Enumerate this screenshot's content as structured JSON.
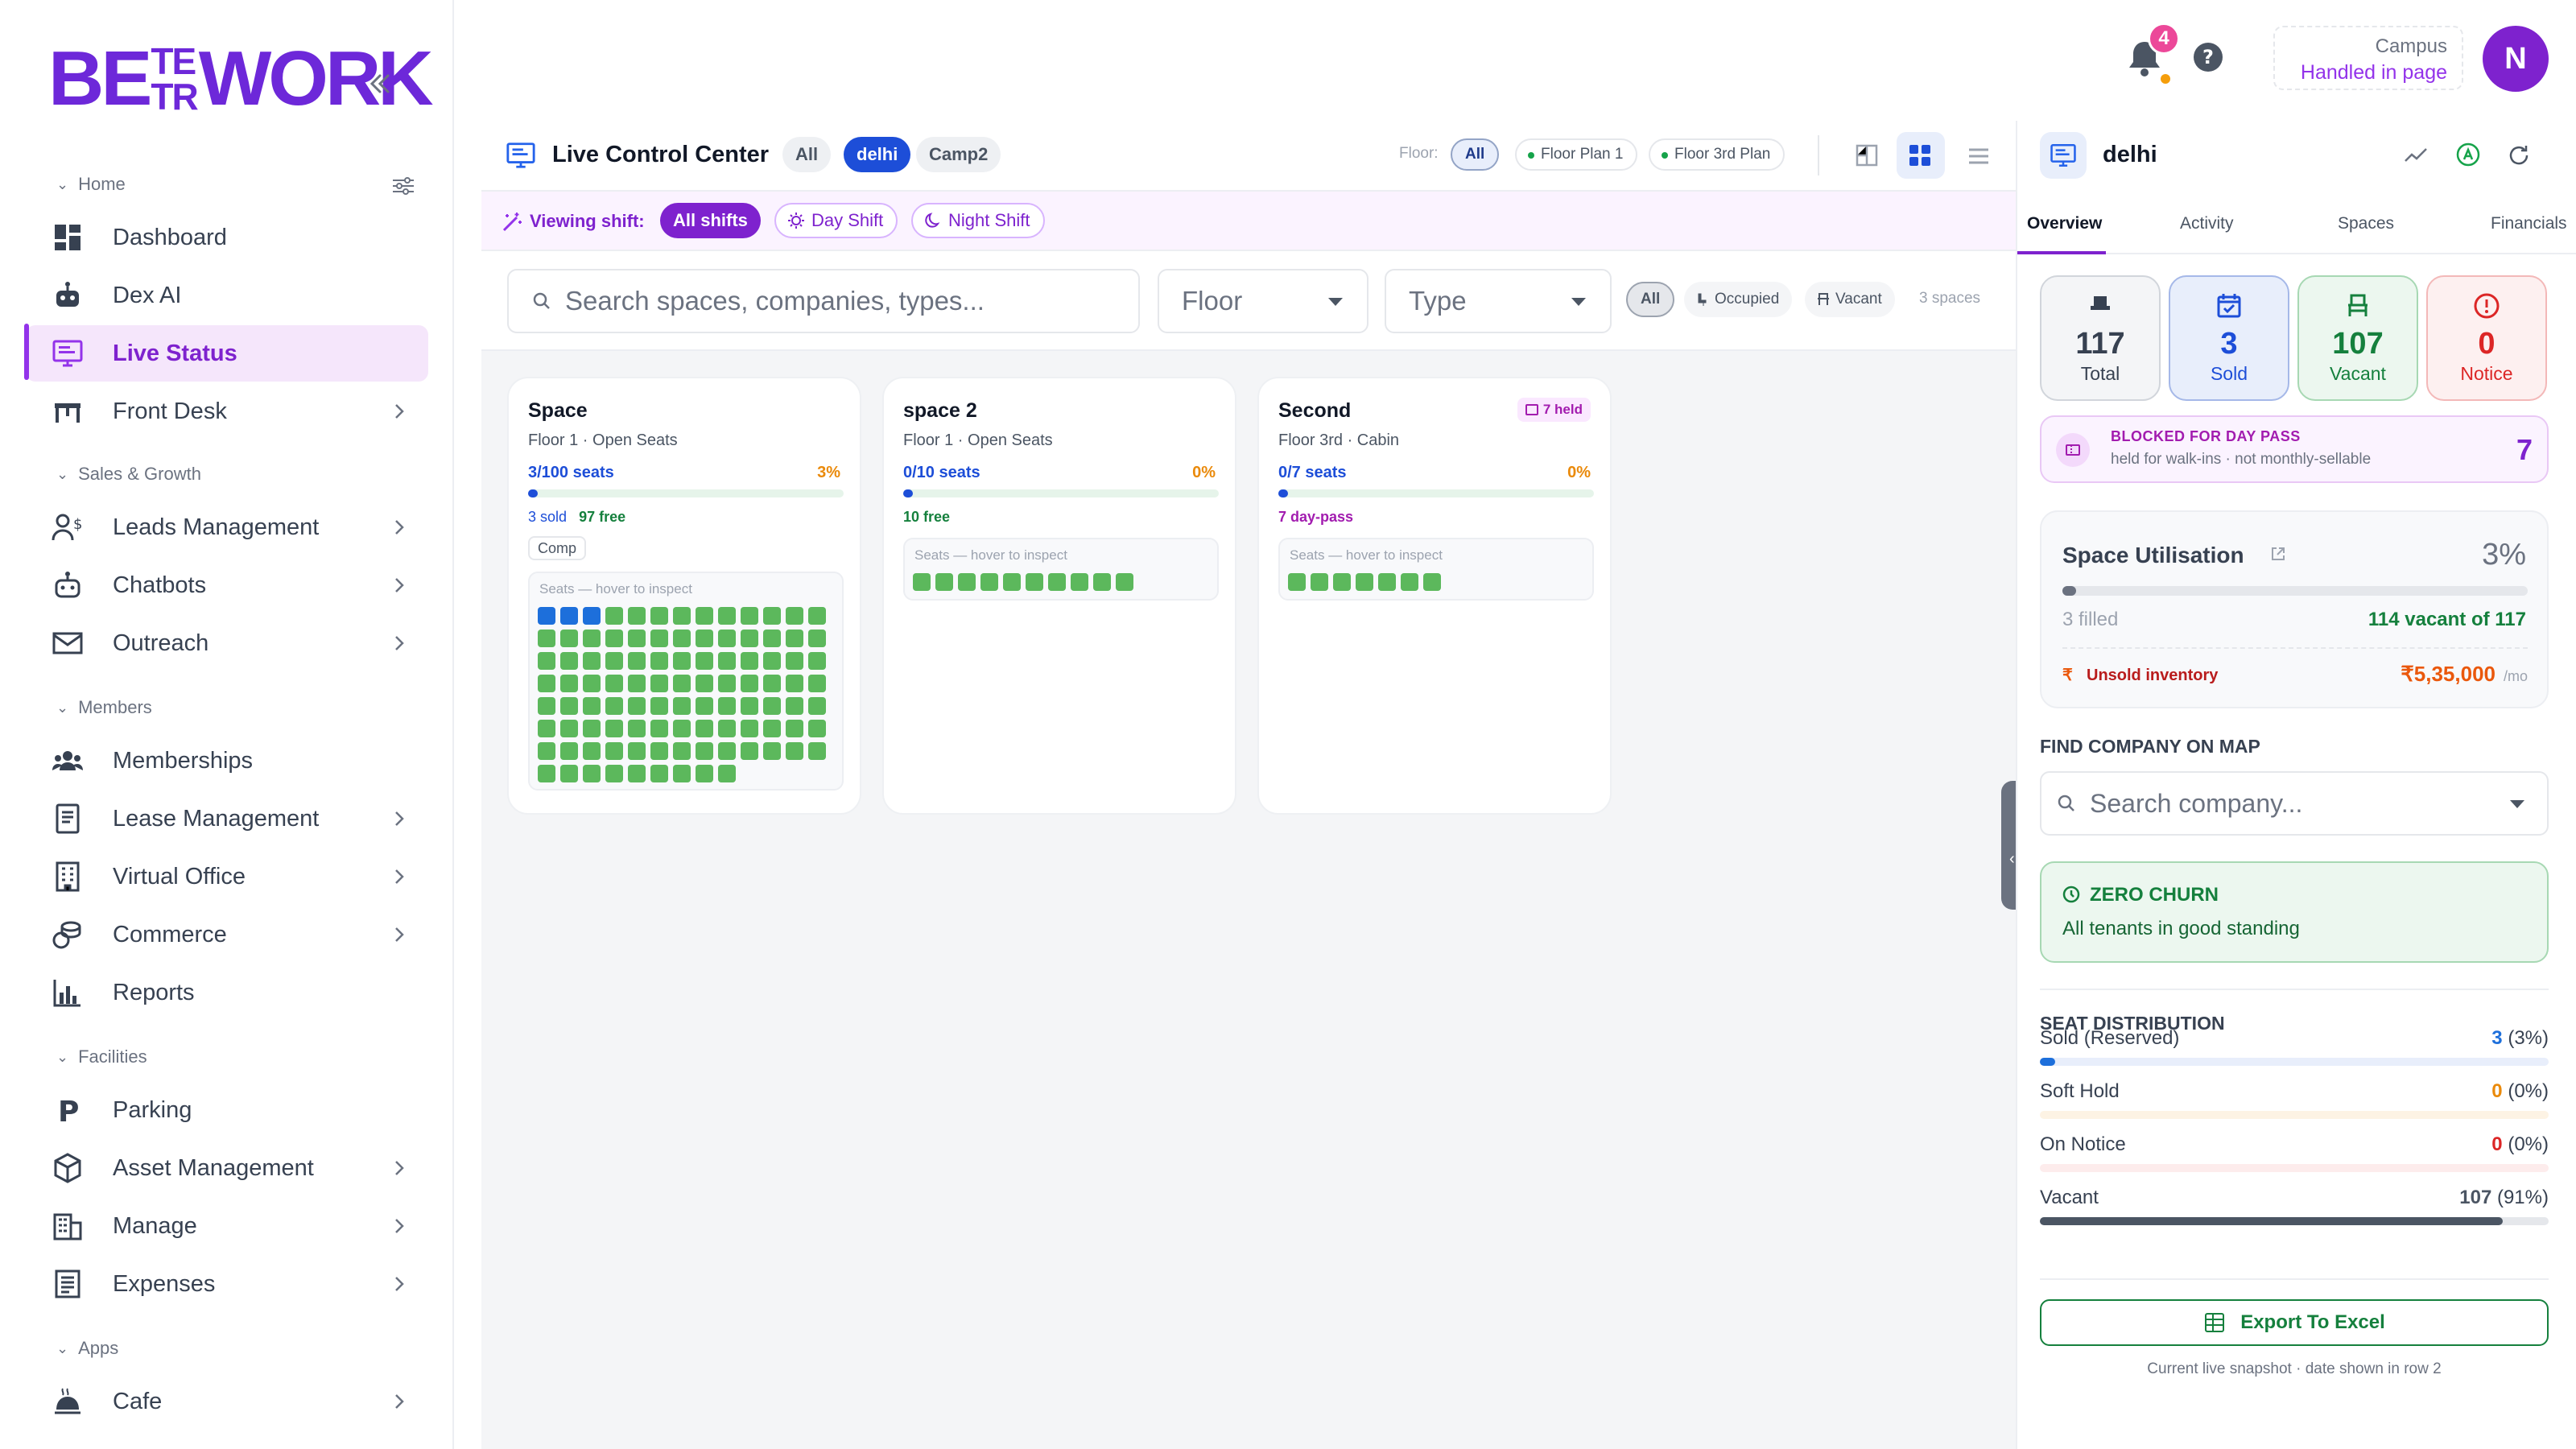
{
  "brand": {
    "logo_left": "BE",
    "logo_stack_top": "TE",
    "logo_stack_bottom": "TR",
    "logo_right": "WORK"
  },
  "sidebar": {
    "sections": {
      "home": "Home",
      "sales": "Sales & Growth",
      "members": "Members",
      "facilities": "Facilities",
      "apps": "Apps"
    },
    "items": [
      {
        "label": "Dashboard",
        "icon": "grid-icon"
      },
      {
        "label": "Dex AI",
        "icon": "robot-icon"
      },
      {
        "label": "Live Status",
        "icon": "monitor-icon",
        "active": true
      },
      {
        "label": "Front Desk",
        "icon": "desk-icon"
      },
      {
        "label": "Leads Management",
        "icon": "users-dollar-icon"
      },
      {
        "label": "Chatbots",
        "icon": "chatbot-icon"
      },
      {
        "label": "Outreach",
        "icon": "mail-icon"
      },
      {
        "label": "Memberships",
        "icon": "group-icon"
      },
      {
        "label": "Lease Management",
        "icon": "document-icon"
      },
      {
        "label": "Virtual Office",
        "icon": "building-icon"
      },
      {
        "label": "Commerce",
        "icon": "coins-icon"
      },
      {
        "label": "Reports",
        "icon": "bar-chart-icon"
      },
      {
        "label": "Parking",
        "icon": "parking-icon"
      },
      {
        "label": "Asset Management",
        "icon": "cube-icon"
      },
      {
        "label": "Manage",
        "icon": "office-icon"
      },
      {
        "label": "Expenses",
        "icon": "receipt-icon"
      },
      {
        "label": "Cafe",
        "icon": "cafe-icon"
      }
    ]
  },
  "header": {
    "notifications": "4",
    "campus_label": "Campus",
    "campus_value": "Handled in page",
    "avatar": "N"
  },
  "toolbar": {
    "title": "Live Control Center",
    "campus_tabs": [
      "All",
      "delhi",
      "Camp2"
    ],
    "floor_label": "Floor:",
    "floor_tabs": [
      "All",
      "Floor Plan 1",
      "Floor 3rd Plan"
    ]
  },
  "shift": {
    "label": "Viewing shift:",
    "options": [
      "All shifts",
      "Day Shift",
      "Night Shift"
    ]
  },
  "filters": {
    "search_placeholder": "Search spaces, companies, types...",
    "floor": "Floor",
    "type": "Type",
    "status": [
      "All",
      "Occupied",
      "Vacant"
    ],
    "count": "3 spaces"
  },
  "cards": [
    {
      "title": "Space",
      "sub": "Floor 1 · Open Seats",
      "seats": "3/100 seats",
      "pct": "3%",
      "fill": 0.03,
      "sold": "3 sold",
      "free": "97 free",
      "tag": "Comp",
      "seat_label": "Seats — hover to inspect",
      "total": 100,
      "sold_n": 3
    },
    {
      "title": "space 2",
      "sub": "Floor 1 · Open Seats",
      "seats": "0/10 seats",
      "pct": "0%",
      "fill": 0,
      "free": "10 free",
      "seat_label": "Seats — hover to inspect",
      "total": 10,
      "sold_n": 0
    },
    {
      "title": "Second",
      "sub": "Floor 3rd · Cabin",
      "seats": "0/7 seats",
      "pct": "0%",
      "fill": 0,
      "free": "7 day-pass",
      "held": "7 held",
      "seat_label": "Seats — hover to inspect",
      "total": 7,
      "sold_n": 0
    }
  ],
  "panel": {
    "title": "delhi",
    "tabs": [
      "Overview",
      "Activity",
      "Spaces",
      "Financials"
    ],
    "stats": [
      {
        "n": "117",
        "l": "Total"
      },
      {
        "n": "3",
        "l": "Sold"
      },
      {
        "n": "107",
        "l": "Vacant"
      },
      {
        "n": "0",
        "l": "Notice"
      }
    ],
    "blocked": {
      "title": "BLOCKED FOR DAY PASS",
      "sub": "held for walk-ins · not monthly-sellable",
      "n": "7"
    },
    "util": {
      "title": "Space Utilisation",
      "pct": "3%",
      "fill": 0.03,
      "filled": "3 filled",
      "vacant": "114 vacant of 117",
      "unsold_label": "Unsold inventory",
      "unsold_value": "₹5,35,000",
      "unsold_unit": "/mo"
    },
    "find": {
      "title": "FIND COMPANY ON MAP",
      "placeholder": "Search company..."
    },
    "churn": {
      "title": "ZERO CHURN",
      "sub": "All tenants in good standing"
    },
    "dist": {
      "title": "SEAT DISTRIBUTION",
      "rows": [
        {
          "name": "Sold (Reserved)",
          "n": "3",
          "p": "(3%)",
          "frac": 0.03,
          "color": "#1d6fdb",
          "track": "#e8eefb"
        },
        {
          "name": "Soft Hold",
          "n": "0",
          "p": "(0%)",
          "frac": 0,
          "color": "#ea8a0b",
          "track": "#fdf3e4"
        },
        {
          "name": "On Notice",
          "n": "0",
          "p": "(0%)",
          "frac": 0,
          "color": "#dc2626",
          "track": "#fdecec"
        },
        {
          "name": "Vacant",
          "n": "107",
          "p": "(91%)",
          "frac": 0.91,
          "color": "#4b5563",
          "track": "#e5e7eb"
        }
      ]
    },
    "export": "Export To Excel",
    "footnote": "Current live snapshot · date shown in row 2"
  }
}
